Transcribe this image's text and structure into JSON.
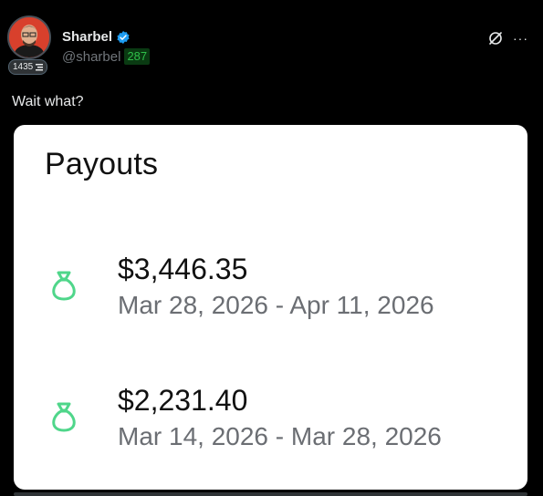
{
  "post": {
    "author": {
      "display_name": "Sharbel",
      "handle": "@sharbel",
      "handle_badge": "287",
      "avatar_badge_count": "1435",
      "verified": true
    },
    "text": "Wait what?",
    "actions": {
      "grok_icon": "grok-icon",
      "more_label": "···"
    }
  },
  "card": {
    "title": "Payouts",
    "payouts": [
      {
        "amount": "$3,446.35",
        "range": "Mar 28, 2026 - Apr 11, 2026",
        "icon": "money-bag-icon"
      },
      {
        "amount": "$2,231.40",
        "range": "Mar 14, 2026 - Mar 28, 2026",
        "icon": "money-bag-icon"
      }
    ],
    "accent_color": "#4fd68a"
  },
  "colors": {
    "background": "#000000",
    "verified_blue": "#1d9bf0",
    "handle_badge_green": "#2fbf4a"
  }
}
